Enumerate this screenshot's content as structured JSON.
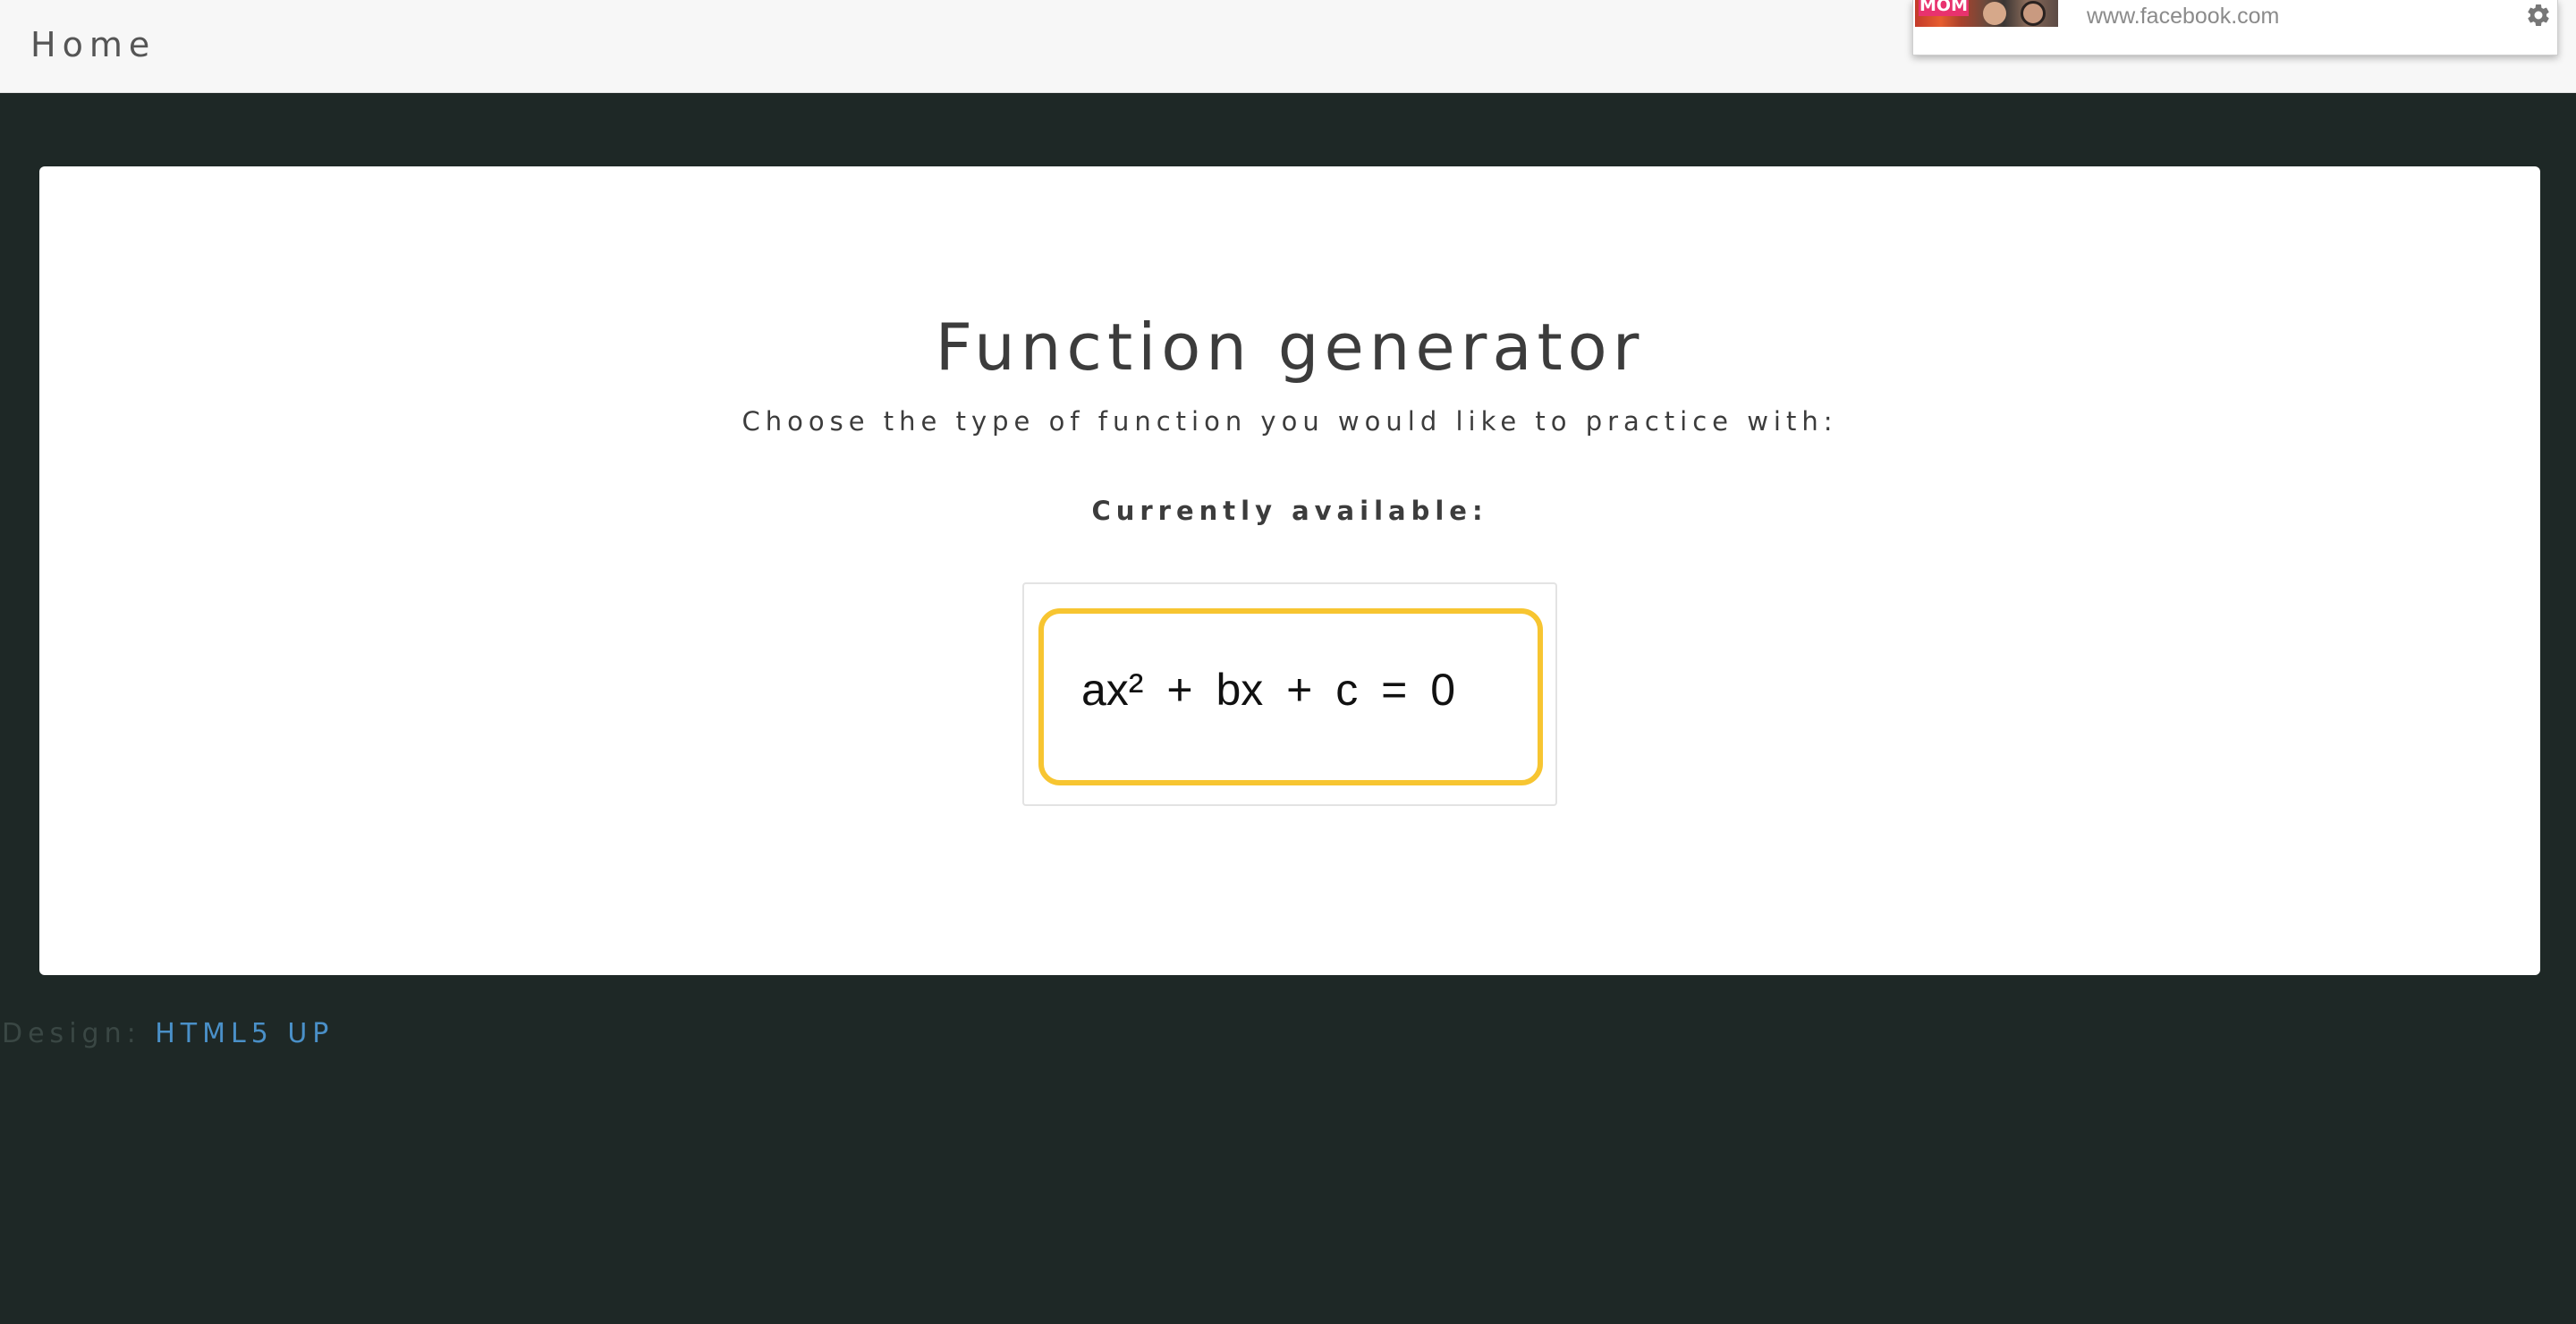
{
  "nav": {
    "home_label": "Home"
  },
  "notification": {
    "url": "www.facebook.com",
    "thumbnail_text": "MOM",
    "settings_icon": "gear-icon"
  },
  "main": {
    "title": "Function generator",
    "subtitle": "Choose the type of function you would like to practice with:",
    "available_heading": "Currently available:",
    "options": [
      {
        "formula": "ax² + bx + c = 0"
      }
    ]
  },
  "footer": {
    "label": "Design: ",
    "link": "HTML5 UP"
  },
  "colors": {
    "background": "#1e2826",
    "topbar": "#f7f7f7",
    "card": "#ffffff",
    "accent_border": "#f7c531",
    "link": "#4a90c8",
    "text": "#3c3c3c"
  }
}
